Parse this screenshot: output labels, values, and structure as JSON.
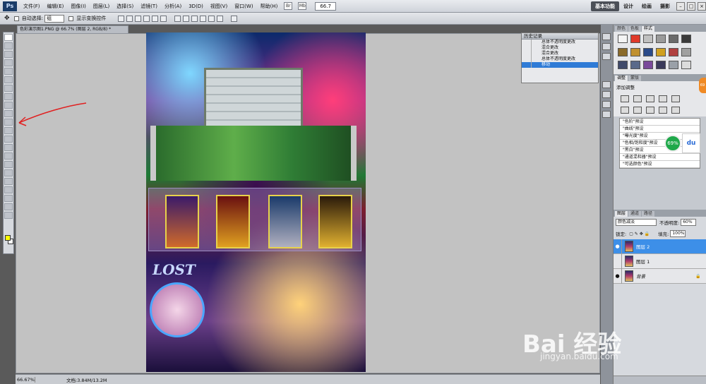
{
  "menubar": {
    "logo": "Ps",
    "items": [
      "文件(F)",
      "编辑(E)",
      "图像(I)",
      "图层(L)",
      "选择(S)",
      "滤镜(T)",
      "分析(A)",
      "3D(D)",
      "视图(V)",
      "窗口(W)",
      "帮助(H)"
    ],
    "mb_icon_1": "Br",
    "mb_icon_2": "Mb",
    "zoom": "66.7",
    "workspaces": [
      "基本功能",
      "设计",
      "绘画",
      "摄影"
    ]
  },
  "options": {
    "auto_select_label": "自动选择:",
    "auto_select_value": "组",
    "transform_label": "显示变换控件"
  },
  "document": {
    "tab_title": "色彩演示图1.PNG @ 66.7% (图层 2, RGB/8) *",
    "art_text_lost": "LOST"
  },
  "status": {
    "zoom": "66.67%",
    "doc_size": "文档:3.84M/13.2M"
  },
  "history": {
    "title": "历史记录",
    "rows": [
      "总体不透明度更改",
      "混合更改",
      "混合更改",
      "总体不透明度更改",
      "移动"
    ]
  },
  "panels": {
    "top_tabs": [
      "颜色",
      "色板",
      "样式"
    ],
    "adj_tabs": [
      "调整",
      "蒙版"
    ],
    "adj_title": "添加调整",
    "presets": [
      "\"色阶\"预设",
      "\"曲线\"预设",
      "\"曝光度\"预设",
      "\"色相/饱和度\"预设",
      "\"黑白\"预设",
      "\"通道混和器\"预设",
      "\"可选颜色\"预设"
    ],
    "layer_tabs": [
      "图层",
      "通道",
      "路径"
    ]
  },
  "layers": {
    "blend_mode": "颜色减淡",
    "opacity_label": "不透明度:",
    "opacity_value": "60%",
    "lock_label": "锁定:",
    "fill_label": "填充:",
    "fill_value": "100%",
    "rows": [
      "图层 2",
      "图层 1",
      "背景"
    ]
  },
  "overlay": {
    "badge": "69%",
    "du": "du",
    "side": "69",
    "watermark": "Bai 经验",
    "watermark_url": "jingyan.baidu.com"
  },
  "colors": {
    "foreground": "#ffff00",
    "background": "#ffffff",
    "selection": "#3d8fe8"
  }
}
